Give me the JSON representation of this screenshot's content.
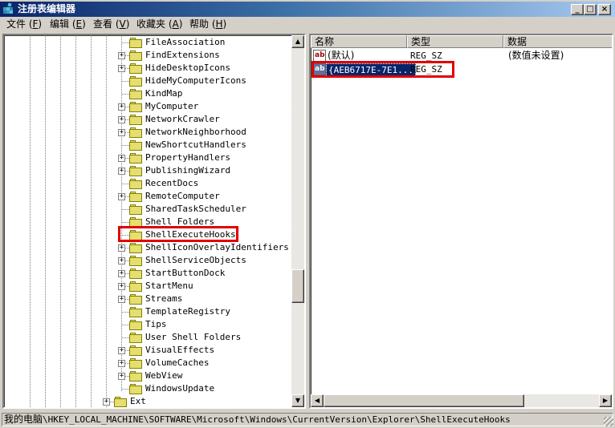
{
  "window": {
    "title": "注册表编辑器",
    "icon": "registry-editor-icon",
    "controls": {
      "minimize": "_",
      "maximize": "□",
      "close": "×"
    }
  },
  "menu": [
    {
      "label": "文件",
      "accel": "F"
    },
    {
      "label": "编辑",
      "accel": "E"
    },
    {
      "label": "查看",
      "accel": "V"
    },
    {
      "label": "收藏夹",
      "accel": "A"
    },
    {
      "label": "帮助",
      "accel": "H"
    }
  ],
  "tree": {
    "items": [
      {
        "label": "FileAssociation",
        "expandable": false
      },
      {
        "label": "FindExtensions",
        "expandable": true
      },
      {
        "label": "HideDesktopIcons",
        "expandable": true
      },
      {
        "label": "HideMyComputerIcons",
        "expandable": false
      },
      {
        "label": "KindMap",
        "expandable": false
      },
      {
        "label": "MyComputer",
        "expandable": true
      },
      {
        "label": "NetworkCrawler",
        "expandable": true
      },
      {
        "label": "NetworkNeighborhood",
        "expandable": true
      },
      {
        "label": "NewShortcutHandlers",
        "expandable": false
      },
      {
        "label": "PropertyHandlers",
        "expandable": true
      },
      {
        "label": "PublishingWizard",
        "expandable": true
      },
      {
        "label": "RecentDocs",
        "expandable": false
      },
      {
        "label": "RemoteComputer",
        "expandable": true
      },
      {
        "label": "SharedTaskScheduler",
        "expandable": false
      },
      {
        "label": "Shell Folders",
        "expandable": false
      },
      {
        "label": "ShellExecuteHooks",
        "expandable": false,
        "selected": true
      },
      {
        "label": "ShellIconOverlayIdentifiers",
        "expandable": true
      },
      {
        "label": "ShellServiceObjects",
        "expandable": true
      },
      {
        "label": "StartButtonDock",
        "expandable": true
      },
      {
        "label": "StartMenu",
        "expandable": true
      },
      {
        "label": "Streams",
        "expandable": true
      },
      {
        "label": "TemplateRegistry",
        "expandable": false
      },
      {
        "label": "Tips",
        "expandable": false
      },
      {
        "label": "User Shell Folders",
        "expandable": false
      },
      {
        "label": "VisualEffects",
        "expandable": true
      },
      {
        "label": "VolumeCaches",
        "expandable": true
      },
      {
        "label": "WebView",
        "expandable": true
      },
      {
        "label": "WindowsUpdate",
        "expandable": false
      }
    ],
    "parent_item": {
      "label": "Ext",
      "expandable": true
    },
    "scroll": {
      "up": "▲",
      "down": "▼"
    }
  },
  "list": {
    "columns": [
      "名称",
      "类型",
      "数据"
    ],
    "rows": [
      {
        "icon": "string-value-icon",
        "name": "(默认)",
        "type": "REG_SZ",
        "data": "(数值未设置)",
        "selected": false
      },
      {
        "icon": "string-value-icon",
        "name": "{AEB6717E-7E1...",
        "type": "REG_SZ",
        "data": "",
        "selected": true
      }
    ],
    "scroll": {
      "left": "◀",
      "right": "▶"
    }
  },
  "status": {
    "computer": "我的电脑",
    "path": "\\HKEY_LOCAL_MACHINE\\SOFTWARE\\Microsoft\\Windows\\CurrentVersion\\Explorer\\ShellExecuteHooks"
  },
  "colors": {
    "highlight": "#e00000",
    "selection": "#0a246a",
    "titlebar_start": "#0a246a",
    "titlebar_end": "#a6caf0"
  }
}
